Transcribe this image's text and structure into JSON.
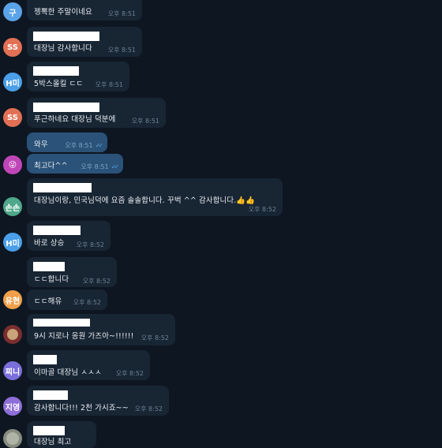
{
  "messages": [
    {
      "sender_initials": "구",
      "avatar_color": "#5aa3e8",
      "text": "젱뽁한 주말이네요",
      "time": "오후 8:51",
      "name_hidden": true
    },
    {
      "sender_initials": "SS",
      "avatar_color": "#e17055",
      "text": "대장님 감사합니다",
      "time": "오후 8:51",
      "name_hidden": true
    },
    {
      "sender_initials": "H미",
      "avatar_color": "#4a9fe8",
      "text": "5박스올킬 ㄷㄷ",
      "time": "오후 8:51",
      "name_hidden": true
    },
    {
      "sender_initials": "SS",
      "avatar_color": "#e17055",
      "text": "푸근하네요 대장님 덕분에",
      "time": "오후 8:51",
      "name_hidden": true
    },
    {
      "text": "와우",
      "time": "오후 8:51",
      "outgoing": true
    },
    {
      "sender_initials": "",
      "avatar_color": "#c046b8",
      "text": "최고다^^",
      "time": "오후 8:51",
      "outgoing": true
    },
    {
      "sender_initials": "손손",
      "avatar_color": "#4fa88a",
      "text": "대장님이랑, 민국님덕에 요즘 솔솔합니다. 꾸벅 ^^ 감사합니다.👍👍",
      "time": "오후 8:52",
      "name_hidden": true
    },
    {
      "sender_initials": "H미",
      "avatar_color": "#4a9fe8",
      "text": "바로 상승",
      "time": "오후 8:52",
      "name_hidden": true
    },
    {
      "text": "ㄷㄷ합니다",
      "time": "오후 8:52",
      "name_hidden": true
    },
    {
      "sender_initials": "유현",
      "avatar_color": "#f0a04b",
      "text": "ㄷㄷ해유",
      "time": "오후 8:52"
    },
    {
      "sender_initials": "",
      "avatar_color": "#7a2e2e",
      "text": "9시 지로나 응원  가즈아~!!!!!!",
      "time": "오후 8:52",
      "name_hidden": true
    },
    {
      "sender_initials": "찌니",
      "avatar_color": "#7b6fdc",
      "text": "이마골 대장님 ㅅㅅㅅ",
      "time": "오후 8:52",
      "name_hidden": true
    },
    {
      "sender_initials": "지영",
      "avatar_color": "#8e6fd8",
      "text": "감사합니다!!! 2천 가시죠~~",
      "time": "오후 8:52",
      "name_hidden": true
    },
    {
      "sender_initials": "",
      "avatar_color": "#888c80",
      "text": "대장님 최고",
      "time": "",
      "name_hidden": true
    }
  ]
}
